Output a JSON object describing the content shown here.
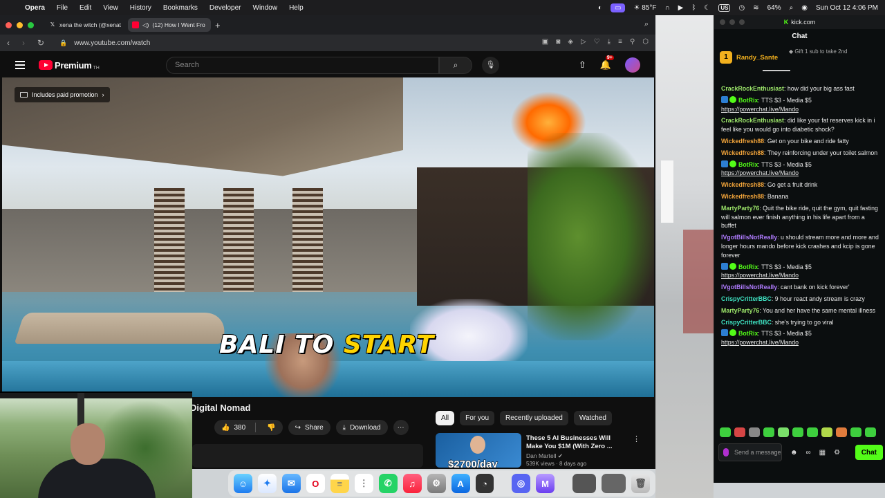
{
  "menubar": {
    "app": "Opera",
    "items": [
      "File",
      "Edit",
      "View",
      "History",
      "Bookmarks",
      "Developer",
      "Window",
      "Help"
    ],
    "weather": "85°F",
    "badge": "US",
    "battery": "64%",
    "clock": "Sun Oct 12  4:06 PM"
  },
  "browser": {
    "tabs": [
      {
        "label": "xena the witch (@xenat",
        "icon": "x-icon"
      },
      {
        "label": "(12) How I Went Fro",
        "icon": "youtube-icon"
      }
    ],
    "url": "www.youtube.com/watch"
  },
  "youtube": {
    "logo": "Premium",
    "logo_sup": "TH",
    "search_placeholder": "Search",
    "notifications": "9+",
    "video": {
      "promo": "Includes paid promotion",
      "caption_white": "BALI TO",
      "caption_yellow": "START"
    },
    "title": "Digital Nomad",
    "likes": "380",
    "share": "Share",
    "download": "Download",
    "chips": [
      "All",
      "For you",
      "Recently uploaded",
      "Watched"
    ],
    "recommendation": {
      "title": "These 5 AI Businesses Will Make You $1M (With Zero ...",
      "channel": "Dan Martell",
      "meta": "539K views · 8 days ago",
      "thumb_text": "$2700/day"
    }
  },
  "chat": {
    "site": "kick.com",
    "header": "Chat",
    "pinned_user": "Randy_Sante",
    "pinned_rank": "1",
    "pinned_text": "Gift 1 sub to take 2nd",
    "messages": [
      {
        "user": "CrackRockEnthusiast",
        "color": "#9ee86b",
        "text": "how did your big ass fast",
        "bot": false,
        "link": ""
      },
      {
        "user": "BotRix",
        "color": "#53fc18",
        "text": "TTS $3 - Media $5",
        "bot": true,
        "link": "https://powerchat.live/Mando"
      },
      {
        "user": "CrackRockEnthusiast",
        "color": "#9ee86b",
        "text": "did like your fat reserves kick in i feel like you would go into diabetic shock?",
        "bot": false,
        "link": ""
      },
      {
        "user": "Wickedfresh88",
        "color": "#f0a33a",
        "text": "Get on your bike and ride fatty",
        "bot": false,
        "link": ""
      },
      {
        "user": "Wickedfresh88",
        "color": "#f0a33a",
        "text": "They reinforcing under your toilet salmon",
        "bot": false,
        "link": ""
      },
      {
        "user": "BotRix",
        "color": "#53fc18",
        "text": "TTS $3 - Media $5",
        "bot": true,
        "link": "https://powerchat.live/Mando"
      },
      {
        "user": "Wickedfresh88",
        "color": "#f0a33a",
        "text": "Go get a fruit drink",
        "bot": false,
        "link": ""
      },
      {
        "user": "Wickedfresh88",
        "color": "#f0a33a",
        "text": "Banana",
        "bot": false,
        "link": ""
      },
      {
        "user": "MartyParty76",
        "color": "#9ee86b",
        "text": "Quit the bike ride, quit the gym, quit fasting will salmon ever finish anything in his life apart from a buffet",
        "bot": false,
        "link": ""
      },
      {
        "user": "IVgotBillsNotReally",
        "color": "#b07cff",
        "text": "u should stream more and more and longer hours mando before kick crashes and kcip is gone forever",
        "bot": false,
        "link": ""
      },
      {
        "user": "BotRix",
        "color": "#53fc18",
        "text": "TTS $3 - Media $5",
        "bot": true,
        "link": "https://powerchat.live/Mando"
      },
      {
        "user": "IVgotBillsNotReally",
        "color": "#b07cff",
        "text": "cant bank on kick forever'",
        "bot": false,
        "link": ""
      },
      {
        "user": "CrispyCritterBBC",
        "color": "#3ee0c0",
        "text": "9 hour react andy stream is crazy",
        "bot": false,
        "link": ""
      },
      {
        "user": "MartyParty76",
        "color": "#9ee86b",
        "text": "You and her have the same mental illness",
        "bot": false,
        "link": ""
      },
      {
        "user": "CrispyCritterBBC",
        "color": "#3ee0c0",
        "text": "she's trying to go viral",
        "bot": false,
        "link": ""
      },
      {
        "user": "BotRix",
        "color": "#53fc18",
        "text": "TTS $3 - Media $5",
        "bot": true,
        "link": "https://powerchat.live/Mando"
      }
    ],
    "input_placeholder": "Send a message",
    "send_label": "Chat"
  },
  "colors": {
    "kick_green": "#53fc18",
    "youtube_red": "#ff0033"
  }
}
